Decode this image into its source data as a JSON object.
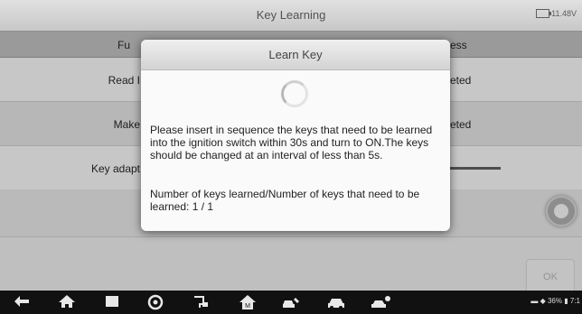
{
  "header": {
    "title": "Key Learning",
    "battery": "11.48V"
  },
  "table": {
    "col_function": "Fu",
    "col_status": "ess",
    "rows": [
      {
        "label": "Read I",
        "status": "eted"
      },
      {
        "label": "Make",
        "status": "eted"
      },
      {
        "label": "Key adapt",
        "status": ""
      }
    ]
  },
  "ok_label": "OK",
  "dialog": {
    "title": "Learn Key",
    "message": "Please insert in sequence the keys that need to be learned into the ignition switch within 30s and turn to ON.The keys should be changed at an interval of less than 5s.",
    "count_text": "Number of keys learned/Number of keys that need to be learned: 1 / 1"
  },
  "status_bar": {
    "battery_pct": "36%",
    "time": "7:1"
  },
  "icons": [
    "back-icon",
    "home-icon",
    "recent-apps-icon",
    "browser-icon",
    "vci-icon",
    "autel-home-icon",
    "car-service-icon",
    "car-icon",
    "car-repair-icon",
    "wifi-icon"
  ]
}
